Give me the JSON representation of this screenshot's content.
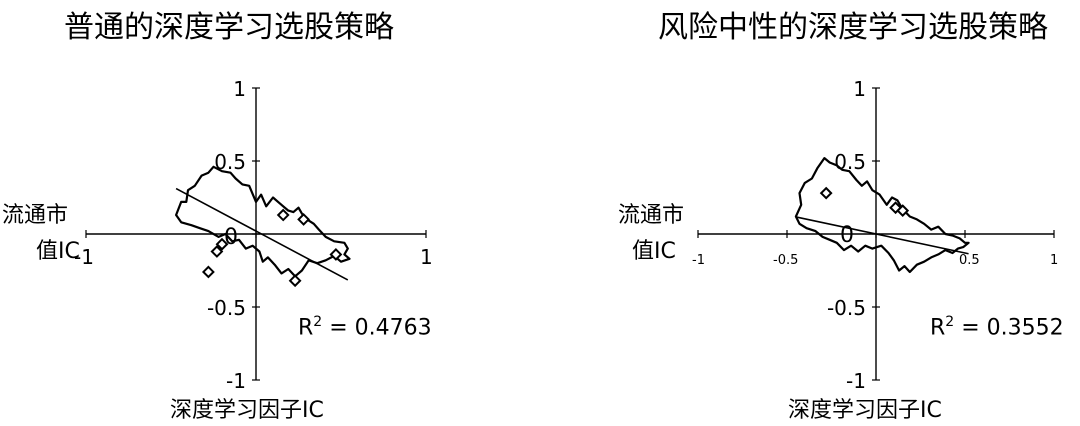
{
  "chart_data": [
    {
      "type": "scatter",
      "title": "普通的深度学习选股策略",
      "xlabel": "深度学习因子IC",
      "ylabel": [
        "流通市",
        "值IC"
      ],
      "xlim": [
        -1,
        1
      ],
      "ylim": [
        -1,
        1
      ],
      "x_ticks": [
        "-1",
        "0",
        "1"
      ],
      "y_ticks": [
        "1",
        "0.5",
        "0",
        "-0.5",
        "-1"
      ],
      "r2_label": "R",
      "r2_sup": "2",
      "r2_value": " = 0.4763",
      "trendline": {
        "slope": -0.62,
        "intercept": 0.02,
        "x_range": [
          -0.47,
          0.54
        ]
      },
      "points": [
        {
          "x": 0.16,
          "y": 0.13
        },
        {
          "x": 0.28,
          "y": 0.1
        },
        {
          "x": -0.2,
          "y": -0.07
        },
        {
          "x": -0.23,
          "y": -0.12
        },
        {
          "x": -0.28,
          "y": -0.26
        },
        {
          "x": 0.23,
          "y": -0.32
        },
        {
          "x": 0.47,
          "y": -0.14
        }
      ],
      "outline": [
        [
          -0.47,
          0.13
        ],
        [
          -0.44,
          0.22
        ],
        [
          -0.41,
          0.22
        ],
        [
          -0.4,
          0.3
        ],
        [
          -0.36,
          0.33
        ],
        [
          -0.32,
          0.4
        ],
        [
          -0.28,
          0.42
        ],
        [
          -0.25,
          0.46
        ],
        [
          -0.2,
          0.43
        ],
        [
          -0.15,
          0.42
        ],
        [
          -0.12,
          0.38
        ],
        [
          -0.08,
          0.34
        ],
        [
          -0.04,
          0.33
        ],
        [
          0.0,
          0.22
        ],
        [
          0.03,
          0.27
        ],
        [
          0.06,
          0.19
        ],
        [
          0.1,
          0.25
        ],
        [
          0.13,
          0.22
        ],
        [
          0.16,
          0.19
        ],
        [
          0.19,
          0.16
        ],
        [
          0.22,
          0.15
        ],
        [
          0.25,
          0.18
        ],
        [
          0.27,
          0.14
        ],
        [
          0.3,
          0.1
        ],
        [
          0.34,
          0.07
        ],
        [
          0.37,
          0.03
        ],
        [
          0.41,
          -0.02
        ],
        [
          0.46,
          -0.05
        ],
        [
          0.52,
          -0.06
        ],
        [
          0.54,
          -0.1
        ],
        [
          0.52,
          -0.14
        ],
        [
          0.55,
          -0.17
        ],
        [
          0.5,
          -0.19
        ],
        [
          0.46,
          -0.15
        ],
        [
          0.41,
          -0.18
        ],
        [
          0.36,
          -0.2
        ],
        [
          0.31,
          -0.18
        ],
        [
          0.27,
          -0.25
        ],
        [
          0.23,
          -0.29
        ],
        [
          0.19,
          -0.24
        ],
        [
          0.15,
          -0.27
        ],
        [
          0.11,
          -0.21
        ],
        [
          0.07,
          -0.16
        ],
        [
          0.04,
          -0.19
        ],
        [
          0.02,
          -0.12
        ],
        [
          -0.02,
          -0.08
        ],
        [
          -0.06,
          -0.1
        ],
        [
          -0.1,
          -0.04
        ],
        [
          -0.14,
          -0.05
        ],
        [
          -0.18,
          0.0
        ],
        [
          -0.22,
          -0.02
        ],
        [
          -0.28,
          0.02
        ],
        [
          -0.33,
          0.04
        ],
        [
          -0.38,
          0.06
        ],
        [
          -0.44,
          0.08
        ]
      ]
    },
    {
      "type": "scatter",
      "title": "风险中性的深度学习选股策略",
      "xlabel": "深度学习因子IC",
      "ylabel": [
        "流通市",
        "值IC"
      ],
      "xlim": [
        -1,
        1
      ],
      "ylim": [
        -1,
        1
      ],
      "x_ticks": [
        "-1",
        "-0.5",
        "0",
        "0.5",
        "1"
      ],
      "y_ticks": [
        "1",
        "0.5",
        "0",
        "-0.5",
        "-1"
      ],
      "r2_label": "R",
      "r2_sup": "2",
      "r2_value": " = 0.3552",
      "trendline": {
        "slope": -0.26,
        "intercept": 0.0,
        "x_range": [
          -0.45,
          0.52
        ]
      },
      "points": [
        {
          "x": 0.11,
          "y": 0.18
        },
        {
          "x": 0.15,
          "y": 0.16
        },
        {
          "x": -0.28,
          "y": 0.28
        }
      ],
      "outline": [
        [
          -0.45,
          0.12
        ],
        [
          -0.42,
          0.2
        ],
        [
          -0.43,
          0.28
        ],
        [
          -0.4,
          0.35
        ],
        [
          -0.36,
          0.38
        ],
        [
          -0.33,
          0.45
        ],
        [
          -0.29,
          0.52
        ],
        [
          -0.26,
          0.49
        ],
        [
          -0.22,
          0.47
        ],
        [
          -0.19,
          0.44
        ],
        [
          -0.15,
          0.43
        ],
        [
          -0.11,
          0.37
        ],
        [
          -0.08,
          0.33
        ],
        [
          -0.05,
          0.36
        ],
        [
          -0.02,
          0.3
        ],
        [
          0.02,
          0.27
        ],
        [
          0.06,
          0.2
        ],
        [
          0.09,
          0.25
        ],
        [
          0.12,
          0.23
        ],
        [
          0.15,
          0.17
        ],
        [
          0.19,
          0.12
        ],
        [
          0.23,
          0.1
        ],
        [
          0.27,
          0.07
        ],
        [
          0.31,
          0.03
        ],
        [
          0.35,
          0.05
        ],
        [
          0.39,
          0.0
        ],
        [
          0.43,
          -0.01
        ],
        [
          0.47,
          -0.03
        ],
        [
          0.5,
          -0.06
        ],
        [
          0.52,
          -0.06
        ],
        [
          0.49,
          -0.09
        ],
        [
          0.46,
          -0.1
        ],
        [
          0.43,
          -0.13
        ],
        [
          0.39,
          -0.11
        ],
        [
          0.35,
          -0.14
        ],
        [
          0.31,
          -0.16
        ],
        [
          0.27,
          -0.19
        ],
        [
          0.23,
          -0.21
        ],
        [
          0.19,
          -0.26
        ],
        [
          0.16,
          -0.22
        ],
        [
          0.13,
          -0.25
        ],
        [
          0.1,
          -0.18
        ],
        [
          0.07,
          -0.13
        ],
        [
          0.03,
          -0.08
        ],
        [
          -0.02,
          -0.1
        ],
        [
          -0.06,
          -0.08
        ],
        [
          -0.1,
          -0.12
        ],
        [
          -0.14,
          -0.08
        ],
        [
          -0.18,
          -0.11
        ],
        [
          -0.22,
          -0.06
        ],
        [
          -0.26,
          -0.04
        ],
        [
          -0.3,
          -0.02
        ],
        [
          -0.34,
          0.02
        ],
        [
          -0.39,
          0.04
        ],
        [
          -0.43,
          0.07
        ]
      ]
    }
  ]
}
